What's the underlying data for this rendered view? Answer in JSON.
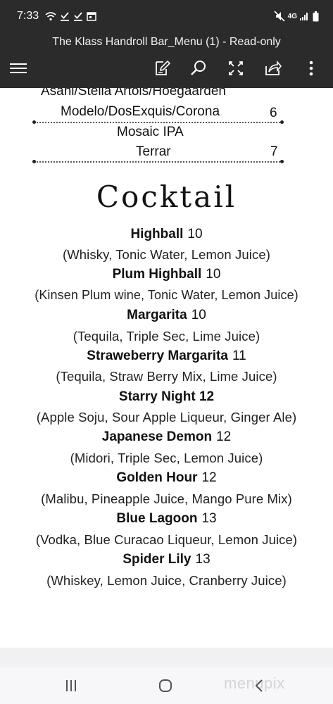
{
  "status_bar": {
    "time": "7:33",
    "network": "4G",
    "icons": [
      "wifi-icon",
      "download-done-icon",
      "download-done-icon",
      "calendar-icon",
      "mute-icon",
      "signal-icon",
      "battery-icon"
    ]
  },
  "app_bar": {
    "title": "The Klass Handroll Bar_Menu (1) - Read-only",
    "icons": [
      "menu-icon",
      "edit-icon",
      "search-icon",
      "fullscreen-icon",
      "share-icon",
      "more-icon"
    ]
  },
  "menu": {
    "beer_partial_line": "Asahi/Stella Artois/Hoegaarden",
    "beer_line_2": "Modelo/DosExquis/Corona",
    "beer_price_1": "6",
    "beer_line_3": "Mosaic IPA",
    "beer_line_4": "Terrar",
    "beer_price_2": "7",
    "section_title": "Cocktail",
    "cocktails": [
      {
        "name": "Highball",
        "price": "10",
        "ingredients": "(Whisky, Tonic Water, Lemon Juice)"
      },
      {
        "name": "Plum Highball",
        "price": "10",
        "ingredients": "(Kinsen Plum wine, Tonic Water, Lemon Juice)"
      },
      {
        "name": "Margarita",
        "price": "10",
        "ingredients": "(Tequila, Triple Sec, Lime Juice)"
      },
      {
        "name": "Straweberry Margarita",
        "price": "11",
        "ingredients": "(Tequila, Straw Berry Mix, Lime Juice)"
      },
      {
        "name": "Starry Night 12",
        "price": "",
        "ingredients": "(Apple Soju, Sour Apple Liqueur, Ginger Ale)"
      },
      {
        "name": "Japanese Demon",
        "price": "12",
        "ingredients": "(Midori, Triple Sec, Lemon Juice)"
      },
      {
        "name": "Golden Hour",
        "price": "12",
        "ingredients": "(Malibu, Pineapple Juice, Mango Pure Mix)"
      },
      {
        "name": "Blue Lagoon",
        "price": "13",
        "ingredients": "(Vodka, Blue Curacao Liqueur, Lemon Juice)"
      },
      {
        "name": "Spider Lily",
        "price": "13",
        "ingredients": "(Whiskey, Lemon Juice, Cranberry Juice)"
      }
    ]
  },
  "nav_bar": {
    "icons": [
      "recent-apps-icon",
      "home-icon",
      "back-icon"
    ],
    "watermark": "menupix"
  },
  "colors": {
    "bar_background": "#2b2b2b",
    "page_background": "#ffffff",
    "nav_background": "#f7f7f9"
  }
}
